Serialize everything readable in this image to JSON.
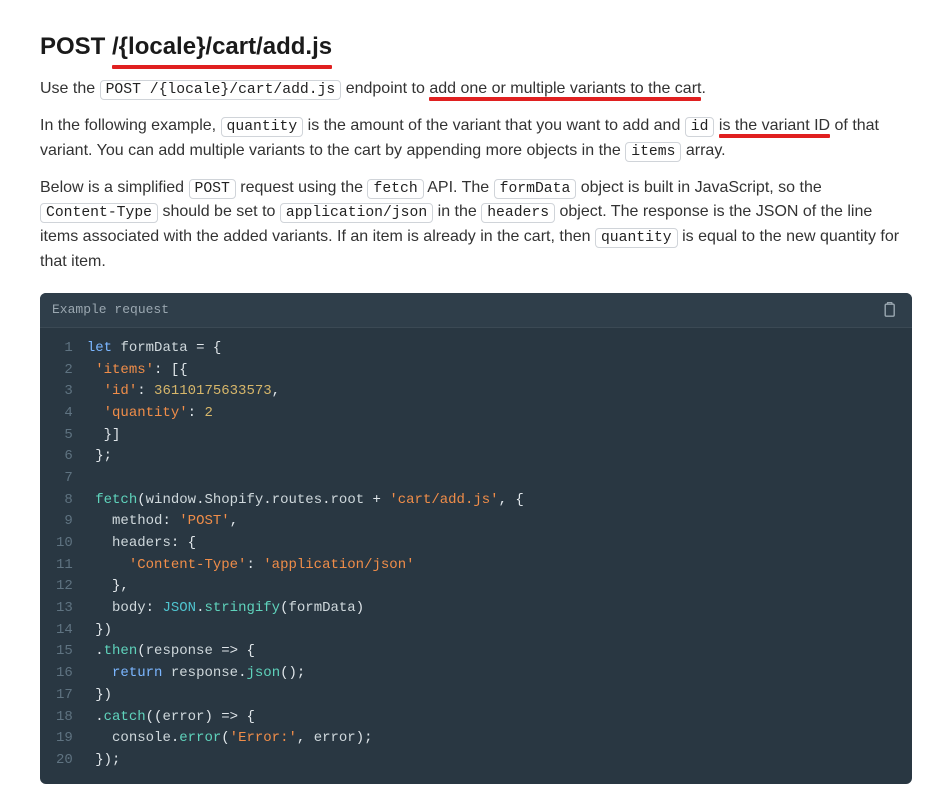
{
  "heading": {
    "method": "POST",
    "path": "/{locale}/cart/add.js"
  },
  "para1": {
    "t1": "Use the ",
    "code1": "POST /{locale}/cart/add.js",
    "t2": " endpoint to ",
    "underlined": "add one or multiple variants to the cart",
    "t3": "."
  },
  "para2": {
    "t1": "In the following example, ",
    "code_quantity": "quantity",
    "t2": " is the amount of the variant that you want to add and ",
    "code_id": "id",
    "t3": " ",
    "underlined": "is the variant ID",
    "t4": " of that variant. You can add multiple variants to the cart by appending more objects in the ",
    "code_items": "items",
    "t5": " array."
  },
  "para3": {
    "t1": "Below is a simplified ",
    "code_post": "POST",
    "t2": " request using the ",
    "code_fetch": "fetch",
    "t3": " API. The ",
    "code_formdata": "formData",
    "t4": " object is built in JavaScript, so the ",
    "code_ct": "Content-Type",
    "t5": " should be set to ",
    "code_appjson": "application/json",
    "t6": " in the ",
    "code_headers": "headers",
    "t7": " object. The response is the JSON of the line items associated with the added variants. If an item is already in the cart, then ",
    "code_quantity": "quantity",
    "t8": " is equal to the new quantity for that item."
  },
  "code": {
    "label": "Example request",
    "lines": {
      "count": 20
    }
  }
}
